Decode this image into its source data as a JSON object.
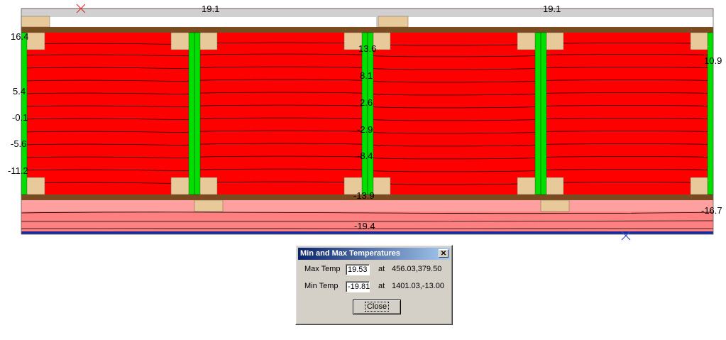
{
  "plot": {
    "top_labels": [
      "19.1",
      "19.1"
    ],
    "left_labels": [
      "16.4",
      "5.4",
      "-0.1",
      "-5.6",
      "-11.2"
    ],
    "center_labels": [
      "13.6",
      "8.1",
      "2.6",
      "-2.9",
      "-8.4",
      "-13.9"
    ],
    "right_labels": [
      "10.9",
      "-16.7"
    ],
    "bottom_label": "-19.4",
    "colors": {
      "main_fill": "#ff0000",
      "stud": "#00e000",
      "block": "#e8c99a",
      "sheathing": "#7a4a20",
      "outer_layer": "#ff8080",
      "top_layer": "#d0d0d0",
      "bottom_edge": "#1a2a9a",
      "marker": "#e03030",
      "marker_bottom": "#3050c0"
    }
  },
  "dialog": {
    "title": "Min and Max Temperatures",
    "close_icon": "✕",
    "max_label": "Max Temp",
    "max_value": "19.53",
    "max_at": "at",
    "max_coords": "456.03,379.50",
    "min_label": "Min Temp",
    "min_value": "-19.81",
    "min_at": "at",
    "min_coords": "1401.03,-13.00",
    "close_button": "Close"
  }
}
